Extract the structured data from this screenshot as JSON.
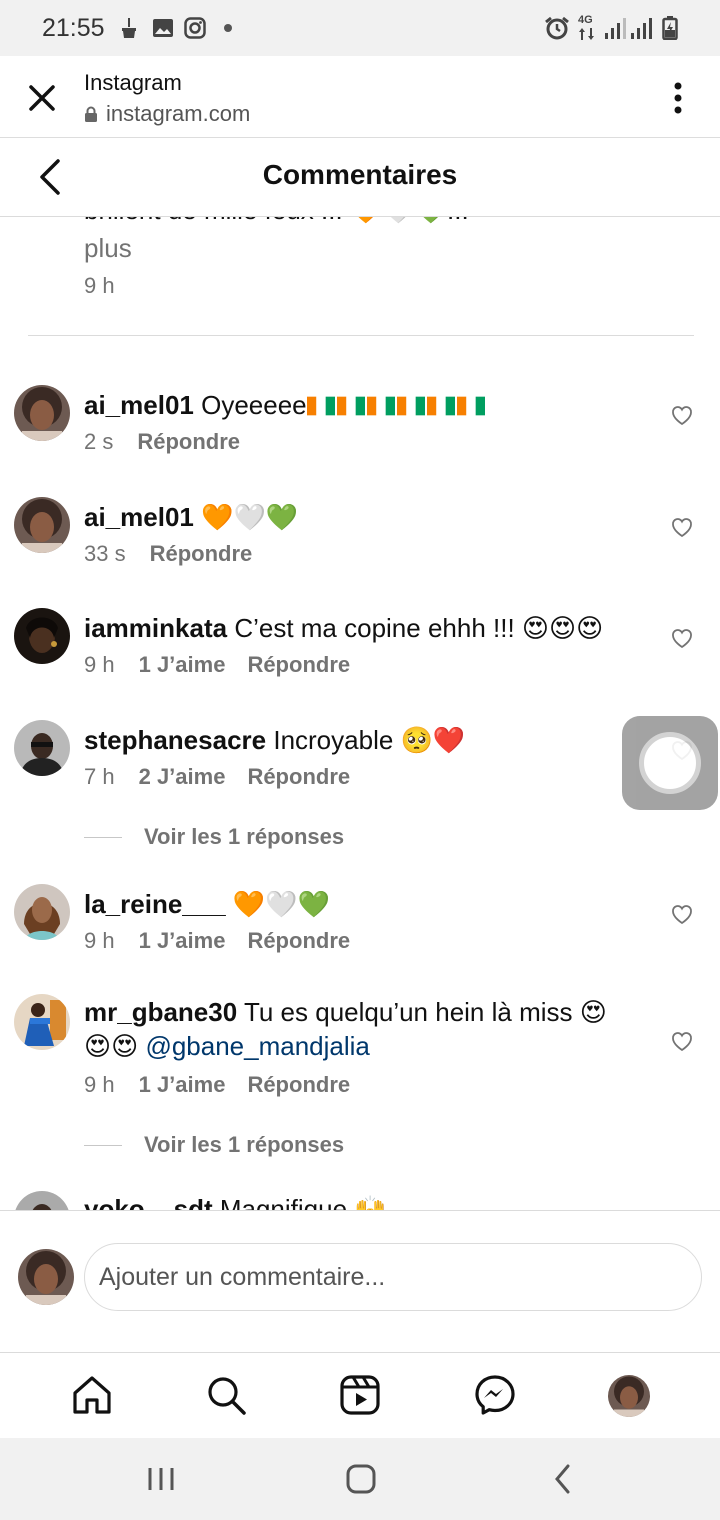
{
  "status_bar": {
    "time": "21:55",
    "network": "4G"
  },
  "custom_tab": {
    "title": "Instagram",
    "url": "instagram.com"
  },
  "header": {
    "title": "Commentaires"
  },
  "caption": {
    "cut_text": "brillent de mille feux !!! 🧡🤍💚...",
    "more_label": "plus",
    "time": "9 h"
  },
  "comments": [
    {
      "username": "ai_mel01",
      "text": "Oyeeeee",
      "flags": 6,
      "time": "2 s",
      "likes": "",
      "reply_label": "Répondre",
      "avatar": "girl-portrait"
    },
    {
      "username": "ai_mel01",
      "text": "🧡🤍💚",
      "time": "33 s",
      "likes": "",
      "reply_label": "Répondre",
      "avatar": "girl-portrait"
    },
    {
      "username": "iamminkata",
      "text": "C’est ma copine ehhh !!! 😍😍😍",
      "time": "9 h",
      "likes": "1 J’aime",
      "reply_label": "Répondre",
      "avatar": "dark-portrait"
    },
    {
      "username": "stephanesacre",
      "text": "Incroyable 🥺❤️",
      "time": "7 h",
      "likes": "2 J’aime",
      "reply_label": "Répondre",
      "avatar": "man-portrait",
      "view_replies": "Voir les 1 réponses"
    },
    {
      "username": "la_reine___",
      "text": "🧡🤍💚",
      "time": "9 h",
      "likes": "1 J’aime",
      "reply_label": "Répondre",
      "avatar": "woman-portrait"
    },
    {
      "username": "mr_gbane30",
      "text": "Tu es quelqu’un hein là miss 😍",
      "text_line2": "😍😍",
      "mention": "@gbane_mandjalia",
      "time": "9 h",
      "likes": "1 J’aime",
      "reply_label": "Répondre",
      "avatar": "man-blue-portrait",
      "view_replies": "Voir les 1 réponses"
    },
    {
      "username": "yoko__sdt",
      "text": "Magnifique 🙌",
      "avatar": "man-portrait"
    }
  ],
  "comment_input": {
    "placeholder": "Ajouter un commentaire..."
  },
  "bottom_nav": [
    "home-icon",
    "search-icon",
    "reels-icon",
    "messenger-icon",
    "profile-avatar"
  ],
  "colors": {
    "secondary_text": "#737373",
    "mention": "#00376b",
    "divider": "#dbdbdb",
    "status_bar_bg": "#f1f1f1"
  }
}
